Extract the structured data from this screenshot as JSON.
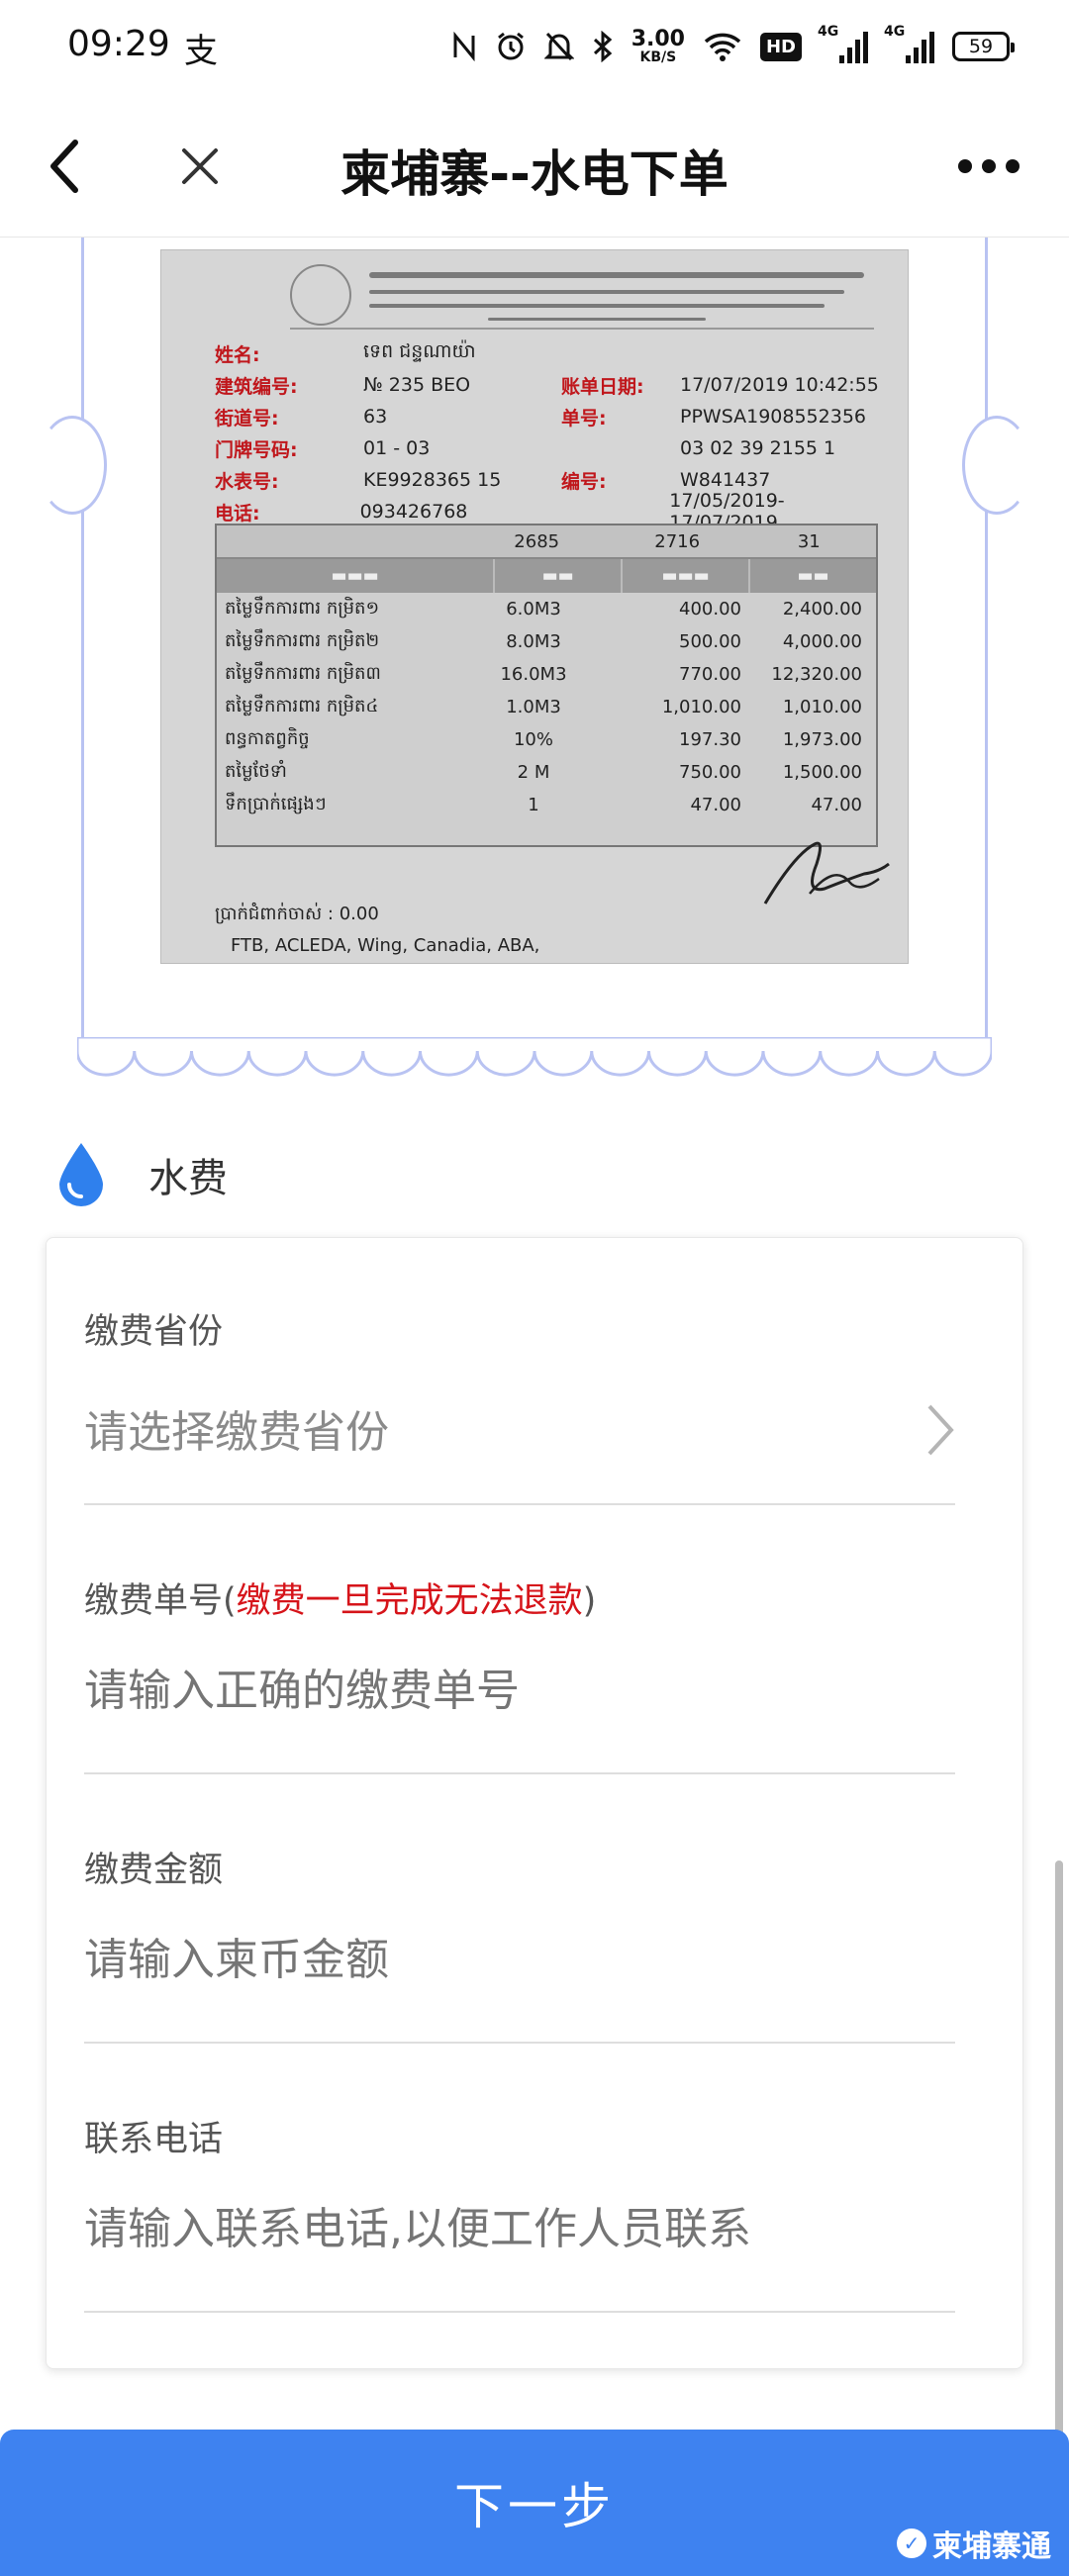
{
  "status_bar": {
    "time": "09:29",
    "app_glyph": "支",
    "speed_value": "3.00",
    "speed_unit": "KB/S",
    "hd_label": "HD",
    "net1": "4G",
    "net2": "4G",
    "battery": "59"
  },
  "navbar": {
    "title": "柬埔寨--水电下单",
    "back_icon": "chevron-left-icon",
    "close_icon": "close-icon",
    "more_icon": "more-dots-icon"
  },
  "bill": {
    "fields": [
      {
        "k": "姓名:",
        "v": "ទេព ជន្ទណាយ៉ា",
        "k2": "",
        "v2": ""
      },
      {
        "k": "建筑编号:",
        "v": "№ 235 BEO",
        "k2": "账单日期:",
        "v2": "17/07/2019 10:42:55"
      },
      {
        "k": "街道号:",
        "v": "63",
        "k2": "单号:",
        "v2": "PPWSA1908552356"
      },
      {
        "k": "门牌号码:",
        "v": "01 - 03",
        "k2": "",
        "v2": "03 02 39 2155 1"
      },
      {
        "k": "水表号:",
        "v": "KE9928365     15",
        "k2": "编号:",
        "v2": "W841437"
      },
      {
        "k": "电话:",
        "v": "093426768",
        "k2": "",
        "v2": "17/05/2019-17/07/2019"
      }
    ],
    "meter": {
      "old": "2685",
      "new": "2716",
      "days": "31"
    },
    "rows": [
      {
        "d": "តម្លៃទឹកការពារ កម្រិត១",
        "q": "6.0M3",
        "p": "400.00",
        "t": "2,400.00"
      },
      {
        "d": "តម្លៃទឹកការពារ កម្រិត២",
        "q": "8.0M3",
        "p": "500.00",
        "t": "4,000.00"
      },
      {
        "d": "តម្លៃទឹកការពារ កម្រិត៣",
        "q": "16.0M3",
        "p": "770.00",
        "t": "12,320.00"
      },
      {
        "d": "តម្លៃទឹកការពារ កម្រិត៤",
        "q": "1.0M3",
        "p": "1,010.00",
        "t": "1,010.00"
      },
      {
        "d": "ពន្ធកាតព្វកិច្ច",
        "q": "10%",
        "p": "197.30",
        "t": "1,973.00"
      },
      {
        "d": "តម្លៃថែទាំ",
        "q": "2 M",
        "p": "750.00",
        "t": "1,500.00"
      },
      {
        "d": "ទឹកប្រាក់ផ្សេងៗ",
        "q": "1",
        "p": "47.00",
        "t": "47.00"
      }
    ],
    "balance": "ប្រាក់ជំពាក់ចាស់ : 0.00",
    "banks": "FTB, ACLEDA, Wing, Canadia, ABA,"
  },
  "section": {
    "icon": "water-drop-icon",
    "title": "水费",
    "accent": "#2f80ed"
  },
  "form": {
    "province": {
      "label": "缴费省份",
      "value": "请选择缴费省份"
    },
    "bill_no": {
      "label": "缴费单号(",
      "warning": "缴费一旦完成无法退款",
      "label_end": ")",
      "placeholder": "请输入正确的缴费单号"
    },
    "amount": {
      "label": "缴费金额",
      "placeholder": "请输入柬币金额"
    },
    "phone": {
      "label": "联系电话",
      "placeholder": "请输入联系电话,以便工作人员联系"
    }
  },
  "next_button": {
    "label": "下一步",
    "color": "#3e82f0"
  },
  "watermark": {
    "text": "柬埔寨通"
  }
}
